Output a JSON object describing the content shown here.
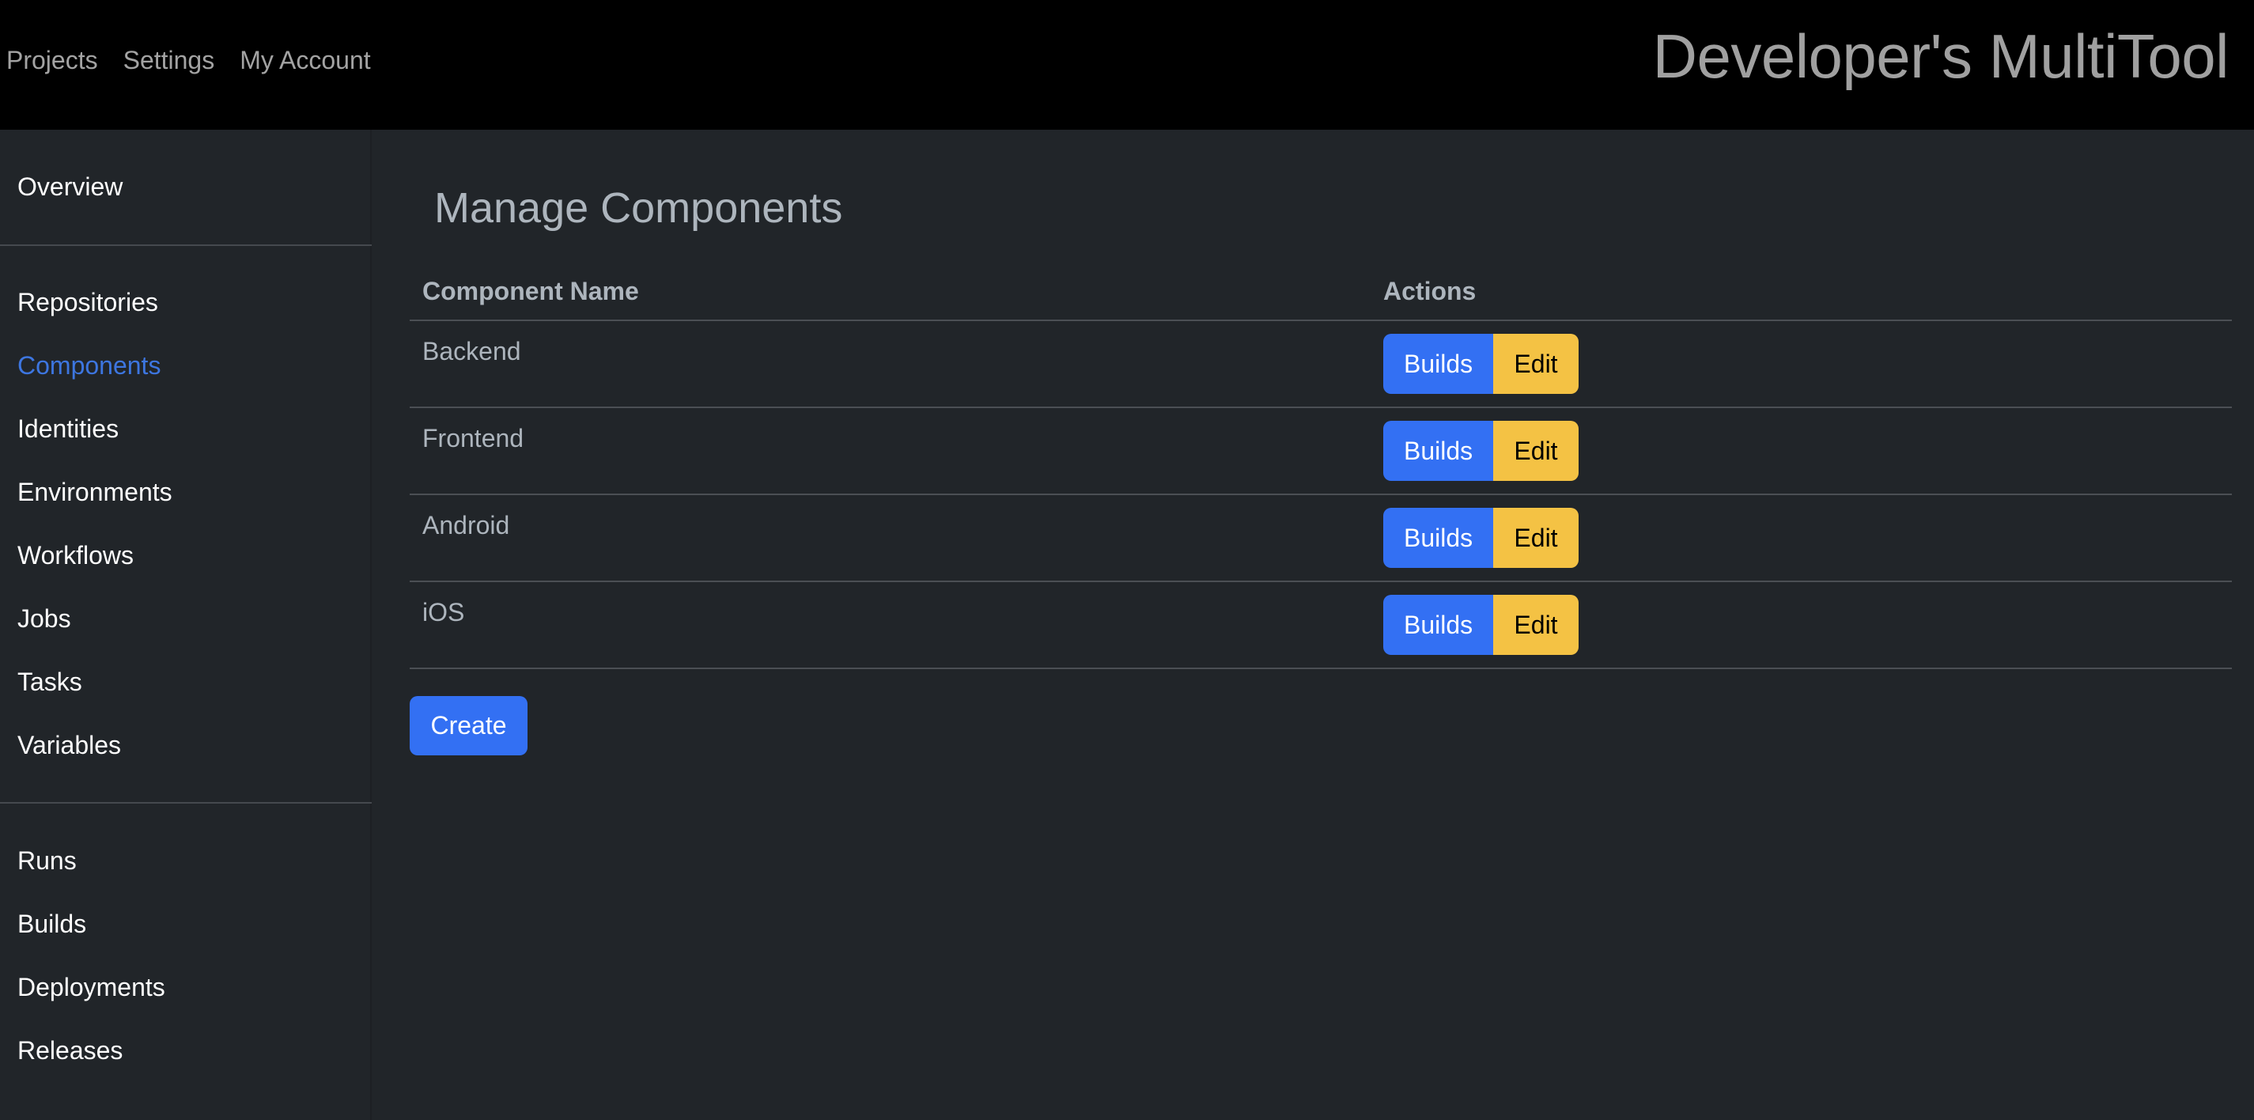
{
  "header": {
    "nav": [
      {
        "label": "Projects"
      },
      {
        "label": "Settings"
      },
      {
        "label": "My Account"
      }
    ],
    "brand": "Developer's MultiTool"
  },
  "sidebar": {
    "groups": [
      {
        "items": [
          {
            "label": "Overview",
            "active": false
          }
        ]
      },
      {
        "items": [
          {
            "label": "Repositories",
            "active": false
          },
          {
            "label": "Components",
            "active": true
          },
          {
            "label": "Identities",
            "active": false
          },
          {
            "label": "Environments",
            "active": false
          },
          {
            "label": "Workflows",
            "active": false
          },
          {
            "label": "Jobs",
            "active": false
          },
          {
            "label": "Tasks",
            "active": false
          },
          {
            "label": "Variables",
            "active": false
          }
        ]
      },
      {
        "items": [
          {
            "label": "Runs",
            "active": false
          },
          {
            "label": "Builds",
            "active": false
          },
          {
            "label": "Deployments",
            "active": false
          },
          {
            "label": "Releases",
            "active": false
          }
        ]
      }
    ],
    "active_color": "#3d76e0"
  },
  "main": {
    "title": "Manage Components",
    "table": {
      "columns": [
        "Component Name",
        "Actions"
      ],
      "rows": [
        {
          "name": "Backend",
          "builds_label": "Builds",
          "edit_label": "Edit"
        },
        {
          "name": "Frontend",
          "builds_label": "Builds",
          "edit_label": "Edit"
        },
        {
          "name": "Android",
          "builds_label": "Builds",
          "edit_label": "Edit"
        },
        {
          "name": "iOS",
          "builds_label": "Builds",
          "edit_label": "Edit"
        }
      ]
    },
    "create_label": "Create"
  },
  "colors": {
    "primary": "#3370f3",
    "warning": "#f4c244",
    "background": "#212529",
    "header_bg": "#000000"
  }
}
